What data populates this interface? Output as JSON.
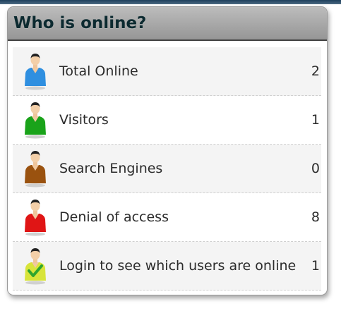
{
  "widget": {
    "title": "Who is online?"
  },
  "rows": [
    {
      "label": "Total Online",
      "count": "2",
      "icon": "user-blue-icon",
      "color": "#2f8fe0"
    },
    {
      "label": "Visitors",
      "count": "1",
      "icon": "user-green-icon",
      "color": "#1aa31a"
    },
    {
      "label": "Search Engines",
      "count": "0",
      "icon": "user-brown-icon",
      "color": "#9a520f"
    },
    {
      "label": "Denial of access",
      "count": "8",
      "icon": "user-red-icon",
      "color": "#e01515"
    },
    {
      "label": "Login to see which users are online",
      "count": "1",
      "icon": "user-check-icon",
      "color": "#d8e43a"
    }
  ],
  "colors": {
    "header_gradient_top": "#bcbcbc",
    "header_gradient_bottom": "#969696",
    "title_text": "#0c2a30",
    "row_shade": "#f4f4f4"
  }
}
